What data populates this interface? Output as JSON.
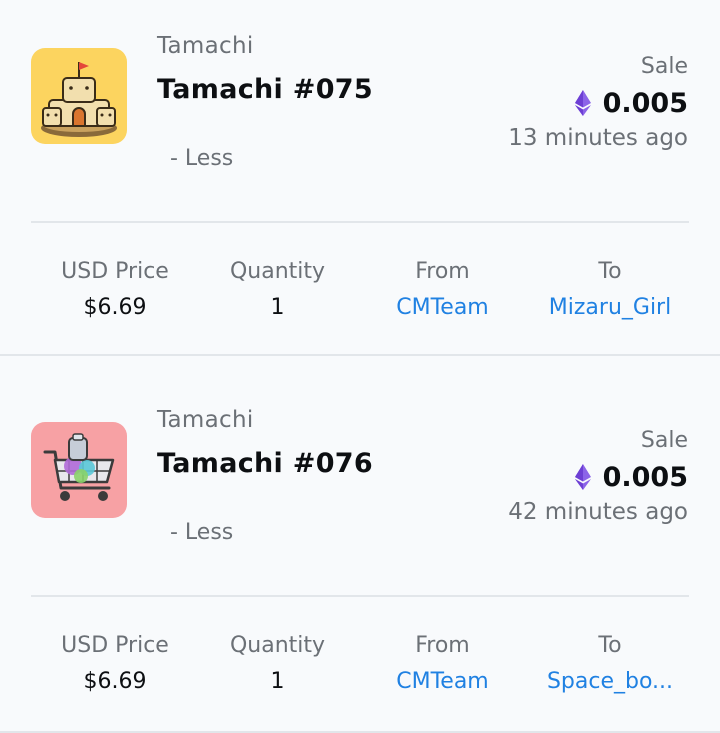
{
  "activity": [
    {
      "collection": "Tamachi",
      "title": "Tamachi #075",
      "toggle_label": "- Less",
      "event": "Sale",
      "price": "0.005",
      "time": "13 minutes ago",
      "details": {
        "usd_label": "USD Price",
        "usd_value": "$6.69",
        "qty_label": "Quantity",
        "qty_value": "1",
        "from_label": "From",
        "from_value": "CMTeam",
        "to_label": "To",
        "to_value": "Mizaru_Girl"
      },
      "thumb_bg": "#fcd45f",
      "thumb_icon": "sandcastle-icon"
    },
    {
      "collection": "Tamachi",
      "title": "Tamachi #076",
      "toggle_label": "- Less",
      "event": "Sale",
      "price": "0.005",
      "time": "42 minutes ago",
      "details": {
        "usd_label": "USD Price",
        "usd_value": "$6.69",
        "qty_label": "Quantity",
        "qty_value": "1",
        "from_label": "From",
        "from_value": "CMTeam",
        "to_label": "To",
        "to_value": "Space_bo..."
      },
      "thumb_bg": "#f7a1a4",
      "thumb_icon": "shopping-cart-icon"
    }
  ],
  "colors": {
    "link": "#2081e2",
    "muted": "#6b7076",
    "eth": "#7b4fd6"
  }
}
